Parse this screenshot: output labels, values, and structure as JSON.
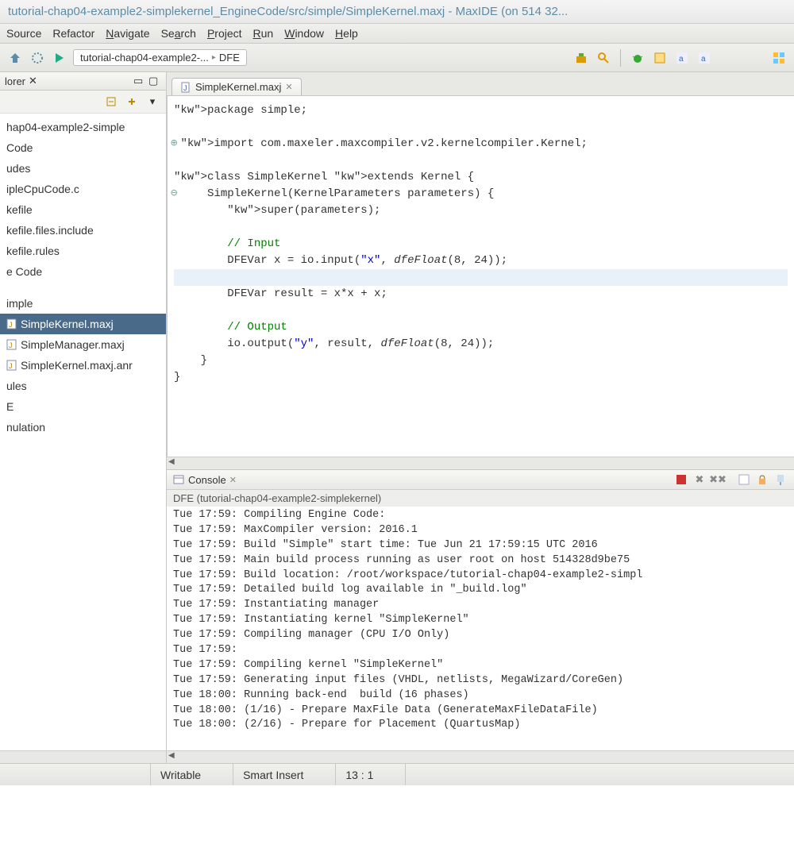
{
  "window_title": "tutorial-chap04-example2-simplekernel_EngineCode/src/simple/SimpleKernel.maxj - MaxIDE  (on 514 32...",
  "menu": [
    "Source",
    "Refactor",
    "Navigate",
    "Search",
    "Project",
    "Run",
    "Window",
    "Help"
  ],
  "menu_underline_idx": {
    "Navigate": 0,
    "Search": 2,
    "Project": 0,
    "Run": 0,
    "Window": 0,
    "Help": 0
  },
  "breadcrumb": {
    "path1": "tutorial-chap04-example2-...",
    "path2": "DFE"
  },
  "explorer": {
    "tab_label": "lorer",
    "items": [
      {
        "label": "hap04-example2-simple"
      },
      {
        "label": "Code"
      },
      {
        "label": "udes"
      },
      {
        "label": "ipleCpuCode.c"
      },
      {
        "label": "kefile"
      },
      {
        "label": "kefile.files.include"
      },
      {
        "label": "kefile.rules"
      },
      {
        "label": "e Code"
      },
      {
        "label": ""
      },
      {
        "label": "imple"
      },
      {
        "label": "SimpleKernel.maxj",
        "selected": true,
        "icon": "j"
      },
      {
        "label": "SimpleManager.maxj",
        "icon": "j"
      },
      {
        "label": "SimpleKernel.maxj.anr",
        "icon": "j"
      },
      {
        "label": "ules"
      },
      {
        "label": "E"
      },
      {
        "label": "nulation"
      }
    ]
  },
  "editor": {
    "tab_label": "SimpleKernel.maxj",
    "code_lines": [
      {
        "t": "package simple;",
        "cls": ""
      },
      {
        "t": "",
        "cls": ""
      },
      {
        "t": "import com.maxeler.maxcompiler.v2.kernelcompiler.Kernel;",
        "cls": "",
        "gutter": "⊕"
      },
      {
        "t": "",
        "cls": ""
      },
      {
        "t": "class SimpleKernel extends Kernel {",
        "cls": ""
      },
      {
        "t": "    SimpleKernel(KernelParameters parameters) {",
        "cls": "",
        "gutter": "⊖"
      },
      {
        "t": "        super(parameters);",
        "cls": ""
      },
      {
        "t": "",
        "cls": ""
      },
      {
        "t": "        // Input",
        "cls": "cm"
      },
      {
        "t": "        DFEVar x = io.input(\"x\", dfeFloat(8, 24));",
        "cls": ""
      },
      {
        "t": "",
        "cls": "hl"
      },
      {
        "t": "        DFEVar result = x*x + x;",
        "cls": ""
      },
      {
        "t": "",
        "cls": ""
      },
      {
        "t": "        // Output",
        "cls": "cm"
      },
      {
        "t": "        io.output(\"y\", result, dfeFloat(8, 24));",
        "cls": ""
      },
      {
        "t": "    }",
        "cls": ""
      },
      {
        "t": "}",
        "cls": ""
      }
    ]
  },
  "console": {
    "tab_label": "Console",
    "subtitle": "DFE (tutorial-chap04-example2-simplekernel)",
    "lines": [
      "Tue 17:59: Compiling Engine Code:",
      "Tue 17:59: MaxCompiler version: 2016.1",
      "Tue 17:59: Build \"Simple\" start time: Tue Jun 21 17:59:15 UTC 2016",
      "Tue 17:59: Main build process running as user root on host 514328d9be75",
      "Tue 17:59: Build location: /root/workspace/tutorial-chap04-example2-simpl",
      "Tue 17:59: Detailed build log available in \"_build.log\"",
      "Tue 17:59: Instantiating manager",
      "Tue 17:59: Instantiating kernel \"SimpleKernel\"",
      "Tue 17:59: Compiling manager (CPU I/O Only)",
      "Tue 17:59:",
      "Tue 17:59: Compiling kernel \"SimpleKernel\"",
      "Tue 17:59: Generating input files (VHDL, netlists, MegaWizard/CoreGen)",
      "Tue 18:00: Running back-end  build (16 phases)",
      "Tue 18:00: (1/16) - Prepare MaxFile Data (GenerateMaxFileDataFile)",
      "Tue 18:00: (2/16) - Prepare for Placement (QuartusMap)"
    ]
  },
  "status": {
    "writable": "Writable",
    "insert": "Smart Insert",
    "pos": "13 : 1"
  }
}
